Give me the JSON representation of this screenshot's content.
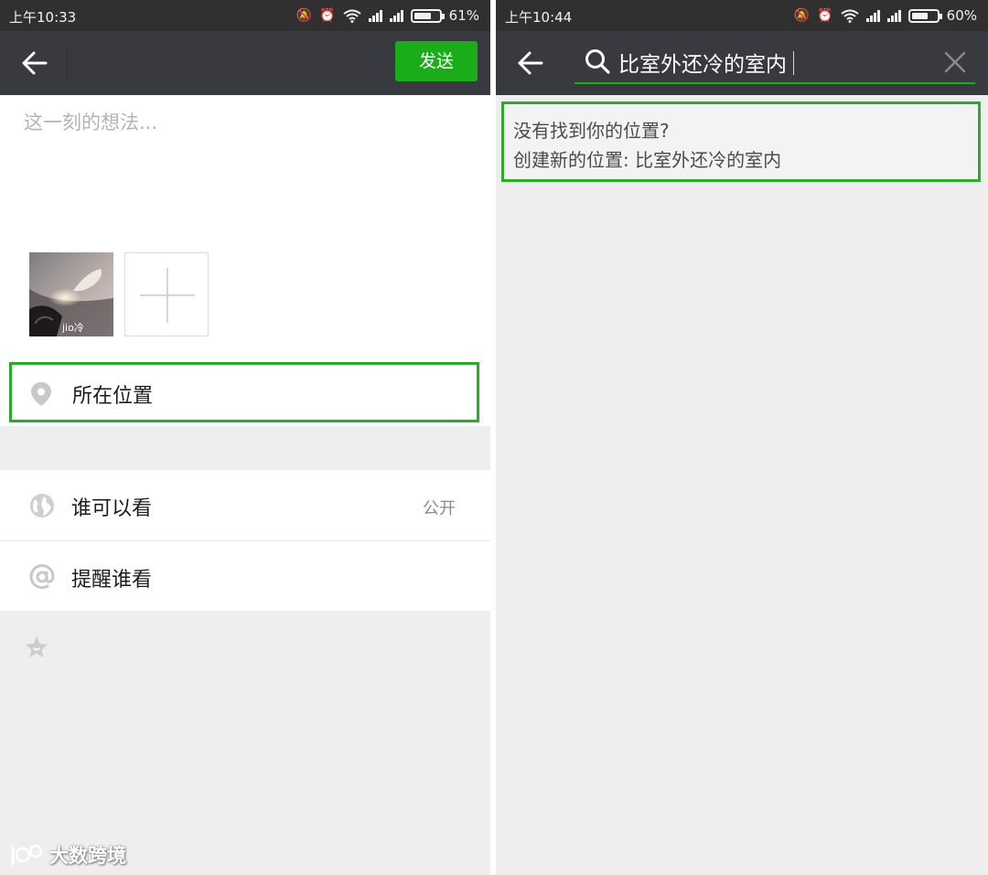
{
  "left_screen": {
    "status_bar": {
      "time": "上午10:33",
      "battery": "61%",
      "battery_level": 0.61
    },
    "send_label": "发送",
    "compose": {
      "placeholder": "这一刻的想法...",
      "photo_caption": "jio冷"
    },
    "location_label": "所在位置",
    "settings": {
      "visibility": {
        "label": "谁可以看",
        "value": "公开"
      },
      "remind": {
        "label": "提醒谁看"
      }
    },
    "watermark": "大数跨境"
  },
  "right_screen": {
    "status_bar": {
      "time": "上午10:44",
      "battery": "60%",
      "battery_level": 0.6
    },
    "search": {
      "query": "比室外还冷的室内"
    },
    "result": {
      "line1": "没有找到你的位置?",
      "line2": "创建新的位置: 比室外还冷的室内"
    }
  },
  "icons": {
    "back": "back-arrow-icon",
    "location": "location-pin-icon",
    "visibility": "globe-icon",
    "remind": "at-sign-icon",
    "favorite": "star-icon",
    "search": "search-icon",
    "clear": "close-icon",
    "add_photo": "plus-icon"
  },
  "colors": {
    "accent_green": "#1aad19",
    "highlight_border": "#2aab2a",
    "navbar": "#393a3f",
    "statusbar": "#303030",
    "background": "#eeeeef"
  }
}
